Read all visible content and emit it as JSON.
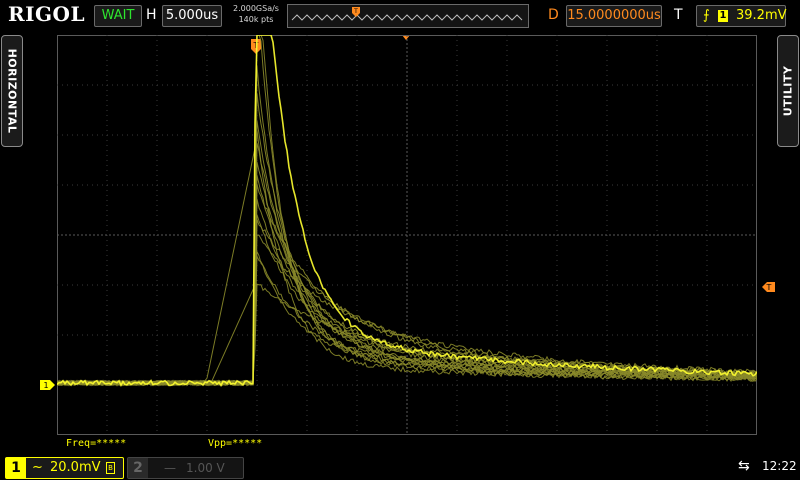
{
  "header": {
    "brand": "RIGOL",
    "run_status": "WAIT",
    "horizontal_label": "H",
    "timebase": "5.000us",
    "sample_rate": "2.000GSa/s",
    "memory_depth": "140k pts",
    "delay_label": "D",
    "delay": "15.0000000us",
    "trigger_label": "T",
    "trigger_edge": "rising-edge-icon",
    "trigger_channel": "1",
    "trigger_level": "39.2mV"
  },
  "side_tabs": {
    "left": "HORIZONTAL",
    "right": "UTILITY"
  },
  "measurements": {
    "freq": "Freq=*****",
    "vpp": "Vpp=*****"
  },
  "channels": [
    {
      "number": "1",
      "coupling": "~",
      "scale": "20.0mV",
      "enabled": true
    },
    {
      "number": "2",
      "coupling": "—",
      "scale": "1.00 V",
      "enabled": false
    }
  ],
  "status": {
    "time": "12:22",
    "usb": "usb-icon"
  },
  "markers": {
    "trigger_position": "T",
    "ch1_ground": "1",
    "trigger_level_marker": "T"
  },
  "colors": {
    "ch1": "#ffff00",
    "trigger": "#ff8a1e",
    "waveform": "#8a8a2a",
    "waveform_bright": "#ffff30",
    "grid": "#3a3a3a",
    "run_status": "#2ee52e"
  }
}
